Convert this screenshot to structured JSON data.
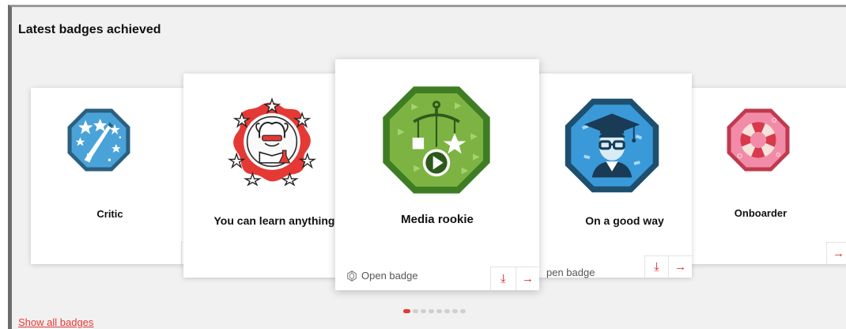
{
  "section": {
    "title": "Latest badges achieved",
    "show_all_label": "Show all badges"
  },
  "open_badge_label": "Open badge",
  "open_badge_partial": "pen badge",
  "badges": [
    {
      "name": "Critic"
    },
    {
      "name": "You can learn anything"
    },
    {
      "name": "Media rookie"
    },
    {
      "name": "On a good way"
    },
    {
      "name": "Onboarder"
    }
  ],
  "icons": {
    "arrow": "→",
    "download": "⤓"
  },
  "carousel": {
    "total_dots": 8,
    "active_index": 0
  },
  "colors": {
    "accent": "#d9262a",
    "critic_fill": "#4aa3d8",
    "critic_border": "#2a5f7f",
    "learn_fill": "#e53935",
    "media_fill": "#7cb342",
    "media_border": "#3e7d24",
    "goodway_fill": "#3a9ad9",
    "goodway_border": "#1f4f6e",
    "onboarder_fill": "#f28ba8",
    "onboarder_border": "#c0394d"
  }
}
